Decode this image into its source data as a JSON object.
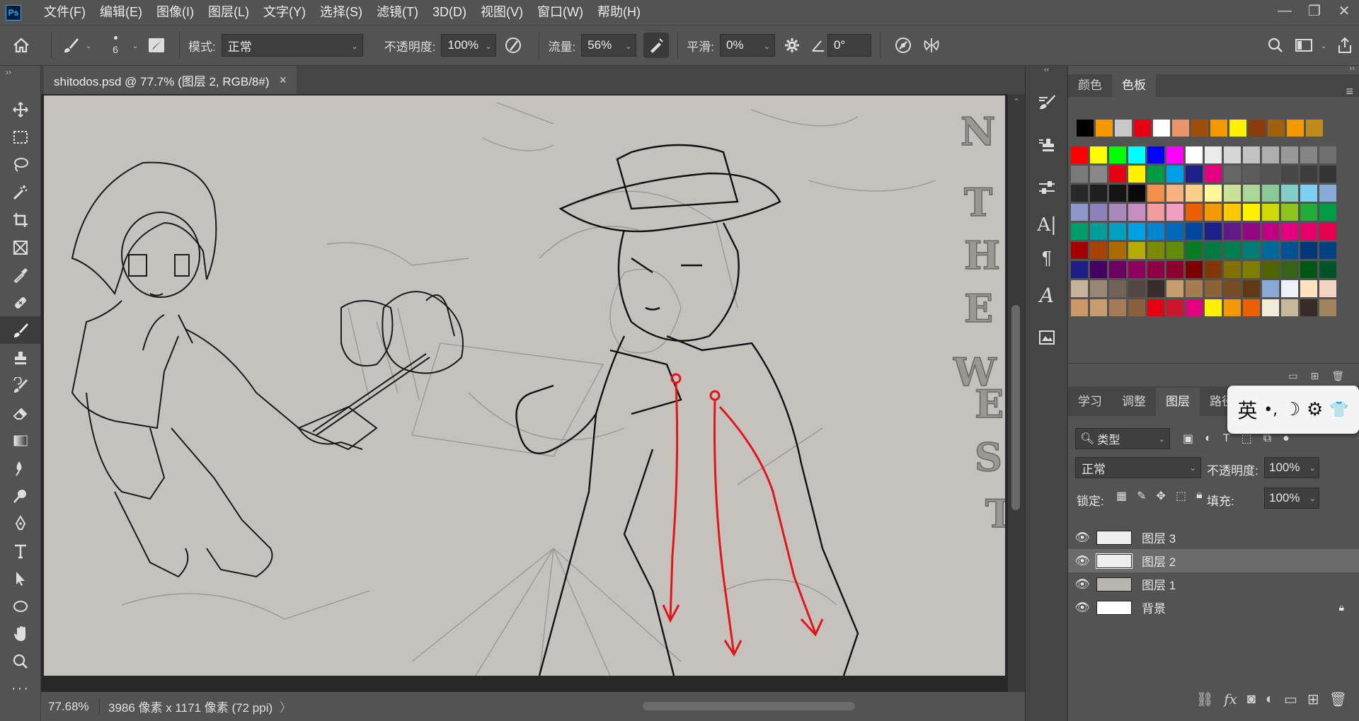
{
  "app": {
    "logo": "Ps"
  },
  "menu": [
    "文件(F)",
    "编辑(E)",
    "图像(I)",
    "图层(L)",
    "文字(Y)",
    "选择(S)",
    "滤镜(T)",
    "3D(D)",
    "视图(V)",
    "窗口(W)",
    "帮助(H)"
  ],
  "window_controls": {
    "minimize": "—",
    "restore": "❐",
    "close": "✕"
  },
  "options": {
    "brush_size": "6",
    "mode_label": "模式:",
    "mode_value": "正常",
    "opacity_label": "不透明度:",
    "opacity_value": "100%",
    "flow_label": "流量:",
    "flow_value": "56%",
    "smoothing_label": "平滑:",
    "smoothing_value": "0%",
    "angle_value": "0°"
  },
  "document": {
    "tab_title": "shitodos.psd @ 77.7% (图层 2, RGB/8#)",
    "close": "×"
  },
  "status": {
    "zoom": "77.68%",
    "doc_info": "3986 像素 x 1171 像素 (72 ppi)",
    "arrow": "〉"
  },
  "canvas_art": {
    "letters": [
      "N",
      "T",
      "H",
      "E",
      "W",
      "E",
      "S",
      "T"
    ]
  },
  "swatches_panel": {
    "tabs": [
      "颜色",
      "色板"
    ],
    "active_tab": "色板",
    "recent_colors": [
      "#000000",
      "#f39800",
      "#c8c8c8",
      "#e60012",
      "#ffffff",
      "#e8956b",
      "#9c4e0a",
      "#f39800",
      "#fff100",
      "#8a3d0a",
      "#a0600d",
      "#f39800",
      "#c08a1a"
    ],
    "grid_colors": [
      "#ff0000",
      "#ffff00",
      "#00ff00",
      "#00ffff",
      "#0000ff",
      "#ff00ff",
      "#ffffff",
      "#ebebeb",
      "#d6d6d6",
      "#c2c2c2",
      "#adadad",
      "#999999",
      "#858585",
      "#707070",
      "#7a7a7a",
      "#888888",
      "#e60012",
      "#fff100",
      "#009944",
      "#00a0e9",
      "#1d2088",
      "#e4007f",
      "#666666",
      "#5c5c5c",
      "#525252",
      "#474747",
      "#3d3d3d",
      "#333333",
      "#292929",
      "#1f1f1f",
      "#141414",
      "#0a0a0a",
      "#f19149",
      "#f6b37f",
      "#facd89",
      "#fff799",
      "#cce198",
      "#acd598",
      "#89c997",
      "#84ccc9",
      "#7ecef4",
      "#88abda",
      "#8c97cb",
      "#8f82bc",
      "#aa89bd",
      "#c490bf",
      "#f29c9f",
      "#f19ec2",
      "#eb6100",
      "#f39800",
      "#fcc800",
      "#fff100",
      "#cfdb00",
      "#8fc31f",
      "#22ac38",
      "#009944",
      "#009b6b",
      "#009e96",
      "#00a0c1",
      "#00a0e9",
      "#0086d1",
      "#0068b7",
      "#00479d",
      "#1d2088",
      "#601986",
      "#920783",
      "#be0081",
      "#e4007f",
      "#e5006a",
      "#e5004f",
      "#a40000",
      "#a84200",
      "#ac6a00",
      "#b7aa00",
      "#7d8a00",
      "#638c0b",
      "#097c25",
      "#007b43",
      "#007c4e",
      "#007e76",
      "#00699a",
      "#005193",
      "#00387a",
      "#004283",
      "#1c1f86",
      "#440062",
      "#6a005f",
      "#8d005d",
      "#8e0045",
      "#8e0030",
      "#7d0000",
      "#813700",
      "#827000",
      "#7e7d00",
      "#516300",
      "#366317",
      "#005714",
      "#00542a",
      "#c7b299",
      "#998675",
      "#736357",
      "#534741",
      "#362e2b",
      "#c69c6d",
      "#a67c52",
      "#8c6239",
      "#754c24",
      "#603813",
      "#8aaad6",
      "#eef1f6",
      "#ffe2c0",
      "#f3d3c2",
      "#cc9966",
      "#c69c6e",
      "#a67b5b",
      "#8b5e3c",
      "#e60012",
      "#c9172c",
      "#e4007f",
      "#fff100",
      "#f39800",
      "#eb6100",
      "#f1ebd9",
      "#c8b89a",
      "#382b25",
      "#a0845c"
    ]
  },
  "layers_panel": {
    "tabs": [
      "学习",
      "调整",
      "图层",
      "路径"
    ],
    "active_tab": "图层",
    "filter_kind": "类型",
    "blend_mode": "正常",
    "opacity_label": "不透明度:",
    "opacity_value": "100%",
    "lock_label": "锁定:",
    "fill_label": "填充:",
    "fill_value": "100%",
    "layers": [
      {
        "name": "图层 3",
        "selected": false,
        "locked": false
      },
      {
        "name": "图层 2",
        "selected": true,
        "locked": false
      },
      {
        "name": "图层 1",
        "selected": false,
        "locked": false
      },
      {
        "name": "背景",
        "selected": false,
        "locked": true
      }
    ]
  },
  "ime": {
    "label": "英",
    "punct": "•,",
    "moon": "☽",
    "gear": "⚙",
    "shirt": "👕"
  }
}
